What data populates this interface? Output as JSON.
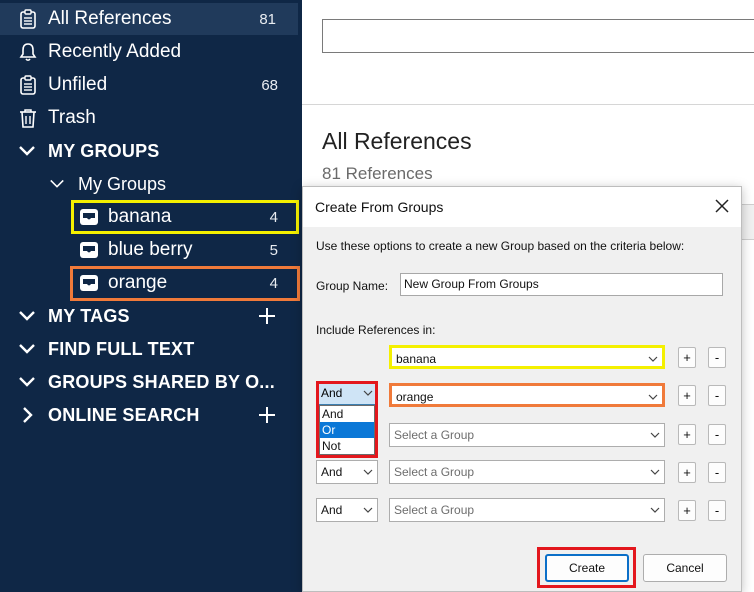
{
  "sidebar": {
    "items": [
      {
        "label": "All References",
        "count": "81",
        "icon": "clipboard-icon"
      },
      {
        "label": "Recently Added",
        "icon": "bell-icon"
      },
      {
        "label": "Unfiled",
        "count": "68",
        "icon": "clipboard-icon"
      },
      {
        "label": "Trash",
        "icon": "trash-icon"
      }
    ],
    "sections": {
      "my_groups": "MY GROUPS",
      "my_groups_folder": "My Groups",
      "my_tags": "MY TAGS",
      "find_full_text": "FIND FULL TEXT",
      "groups_shared": "GROUPS SHARED BY O...",
      "online_search": "ONLINE SEARCH"
    },
    "groups": [
      {
        "label": "banana",
        "count": "4"
      },
      {
        "label": "blue berry",
        "count": "5"
      },
      {
        "label": "orange",
        "count": "4"
      }
    ]
  },
  "main": {
    "title": "All References",
    "subtitle": "81 References"
  },
  "dialog": {
    "title": "Create From Groups",
    "description": "Use these options to create a new Group based on the criteria below:",
    "group_name_label": "Group Name:",
    "group_name_value": "New Group From Groups",
    "include_label": "Include References in:",
    "rows": [
      {
        "group": "banana"
      },
      {
        "operator": "And",
        "group": "orange"
      },
      {
        "operator": "And",
        "group": "Select a Group"
      },
      {
        "operator": "And",
        "group": "Select a Group"
      },
      {
        "operator": "And",
        "group": "Select a Group"
      }
    ],
    "operator_options": [
      "And",
      "Or",
      "Not"
    ],
    "plus": "+",
    "minus": "-",
    "create_label": "Create",
    "cancel_label": "Cancel"
  },
  "colors": {
    "sidebar_bg": "#0f2746",
    "highlight_yellow": "#f4f000",
    "highlight_orange": "#f07a3a",
    "highlight_red": "#e3171d",
    "selection_blue": "#0b78d7"
  }
}
